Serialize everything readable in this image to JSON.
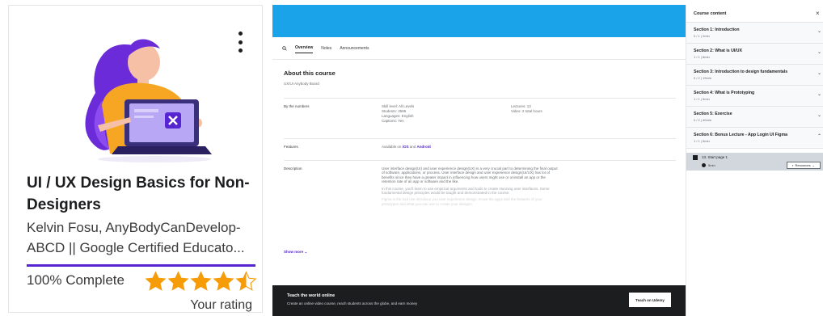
{
  "card": {
    "title": "UI / UX Design Basics for Non-Designers",
    "authors_line1": "Kelvin Fosu, AnyBodyCanDevelop-",
    "authors_line2": "ABCD || Google Certified Educato...",
    "progress_percent": 100,
    "progress_text": "100% Complete",
    "rating_stars": 4.5,
    "rating_label": "Your rating",
    "accent_color": "#5624d0",
    "star_color": "#f69c08"
  },
  "player": {
    "tabs": [
      {
        "label": "Overview",
        "active": true
      },
      {
        "label": "Notes",
        "active": false
      },
      {
        "label": "Announcements",
        "active": false
      }
    ],
    "about_title": "About this course",
    "about_subtitle": "UX/UI Anybody Board",
    "by_numbers_label": "By the numbers",
    "by_numbers_col1": [
      "Skill level: All Levels",
      "Students: 3586",
      "Languages: English",
      "Captions: Yes"
    ],
    "by_numbers_col2": [
      "Lectures: 13",
      "Video: 2 total hours"
    ],
    "features_label": "Features",
    "features_prefix": "Available on",
    "features_ios": "iOS",
    "features_and": "and",
    "features_android": "Android",
    "description_label": "Description",
    "description_p1": "User interface design(UI) and user experience design(UX) is a very crucial part to determining the final output of software, applications, or process. User interface design and user experience design(UI/UX) has lot of benefits since they have a greater impact in influencing how users might use or uninstall an app or the retention rate of an app or software and the like.",
    "description_p2": "In this course, you'll learn to use empirical arguments and tools to create stunning user interfaces. Some fundamental design principles would be taught and demonstrated in the course.",
    "description_p3": "Figma is the tool use introduce you user experience design. Know the apps and the features of your prototypes and what you can use to create your designs.",
    "show_more": "Show more",
    "teach_title": "Teach the world online",
    "teach_subtitle": "Create an online video course, reach students across the globe, and earn money",
    "teach_button": "Teach on Udemy",
    "video_color": "#1aa3e8"
  },
  "sidebar": {
    "title": "Course content",
    "close_icon": "close-icon",
    "sections": [
      {
        "title": "Section 1: Introduction",
        "meta": "0 / 1 | 2min"
      },
      {
        "title": "Section 2: What is UI/UX",
        "meta": "1 / 1 | 8min"
      },
      {
        "title": "Section 3: Introduction to design fundamentals",
        "meta": "0 / 2 | 19min"
      },
      {
        "title": "Section 4: What is Prototyping",
        "meta": "1 / 1 | 5min"
      },
      {
        "title": "Section 5: Exercise",
        "meta": "0 / 2 | 40min"
      },
      {
        "title": "Section 6: Bonus Lecture - App Login UI Figma",
        "meta": "1 / 1 | 5min"
      }
    ],
    "lesson_title": "13. Start page 1",
    "lesson_duration": "5min",
    "resources_label": "Resources"
  }
}
